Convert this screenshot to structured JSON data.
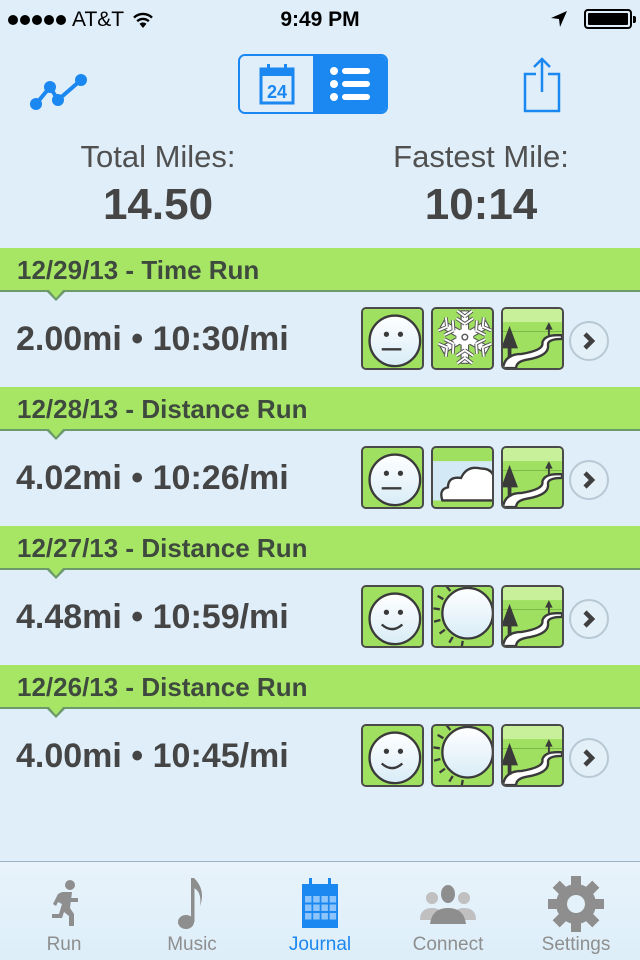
{
  "status_bar": {
    "signal_dots": 5,
    "carrier": "AT&T",
    "time": "9:49 PM",
    "battery_level": 1.0
  },
  "toolbar": {
    "chart_icon": "line-chart-icon",
    "segments": [
      {
        "name": "calendar",
        "icon": "calendar-icon",
        "label": "24",
        "selected": false
      },
      {
        "name": "list",
        "icon": "list-icon",
        "selected": true
      }
    ],
    "share_icon": "share-icon"
  },
  "summary": {
    "total_label": "Total Miles:",
    "total_value": "14.50",
    "fastest_label": "Fastest Mile:",
    "fastest_value": "10:14"
  },
  "runs": [
    {
      "title": "12/29/13 - Time Run",
      "stats": "2.00mi • 10:30/mi",
      "mood": "neutral",
      "weather": "snow",
      "terrain": "trail"
    },
    {
      "title": "12/28/13 - Distance Run",
      "stats": "4.02mi • 10:26/mi",
      "mood": "neutral",
      "weather": "cloudy",
      "terrain": "trail"
    },
    {
      "title": "12/27/13 - Distance Run",
      "stats": "4.48mi • 10:59/mi",
      "mood": "happy",
      "weather": "sunny",
      "terrain": "trail"
    },
    {
      "title": "12/26/13 - Distance Run",
      "stats": "4.00mi • 10:45/mi",
      "mood": "happy",
      "weather": "sunny",
      "terrain": "trail"
    }
  ],
  "tabs": [
    {
      "label": "Run",
      "icon": "runner-icon",
      "active": false
    },
    {
      "label": "Music",
      "icon": "music-note-icon",
      "active": false
    },
    {
      "label": "Journal",
      "icon": "calendar-grid-icon",
      "active": true
    },
    {
      "label": "Connect",
      "icon": "people-icon",
      "active": false
    },
    {
      "label": "Settings",
      "icon": "gear-icon",
      "active": false
    }
  ],
  "colors": {
    "accent": "#1b87f0",
    "header_green": "#a7e665",
    "background": "#dfeef9",
    "text": "#454545",
    "tab_inactive": "#8e8e8e"
  }
}
